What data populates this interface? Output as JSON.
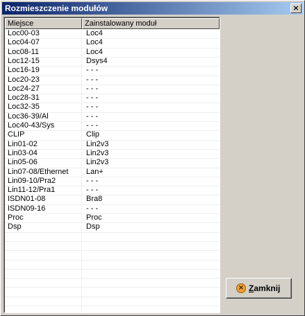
{
  "window": {
    "title": "Rozmieszczenie modułów",
    "close_glyph": "×"
  },
  "table": {
    "columns": [
      "Miejsce",
      "Zainstalowany moduł"
    ],
    "rows": [
      [
        "Loc00-03",
        "Loc4"
      ],
      [
        "Loc04-07",
        "Loc4"
      ],
      [
        "Loc08-11",
        "Loc4"
      ],
      [
        "Loc12-15",
        "Dsys4"
      ],
      [
        "Loc16-19",
        "- - -"
      ],
      [
        "Loc20-23",
        "- - -"
      ],
      [
        "Loc24-27",
        "- - -"
      ],
      [
        "Loc28-31",
        "- - -"
      ],
      [
        "Loc32-35",
        "- - -"
      ],
      [
        "Loc36-39/Al",
        "- - -"
      ],
      [
        "Loc40-43/Sys",
        "- - -"
      ],
      [
        "CLIP",
        "Clip"
      ],
      [
        "Lin01-02",
        "Lin2v3"
      ],
      [
        "Lin03-04",
        "Lin2v3"
      ],
      [
        "Lin05-06",
        "Lin2v3"
      ],
      [
        "Lin07-08/Ethernet",
        "Lan+"
      ],
      [
        "Lin09-10/Pra2",
        "- - -"
      ],
      [
        "Lin11-12/Pra1",
        "- - -"
      ],
      [
        "ISDN01-08",
        "Bra8"
      ],
      [
        "ISDN09-16",
        "- - -"
      ],
      [
        "Proc",
        "Proc"
      ],
      [
        "Dsp",
        "Dsp"
      ]
    ],
    "empty_rows": 9
  },
  "close_button": {
    "label_underlined": "Z",
    "label_rest": "amknij",
    "icon": "close-circle-icon"
  }
}
